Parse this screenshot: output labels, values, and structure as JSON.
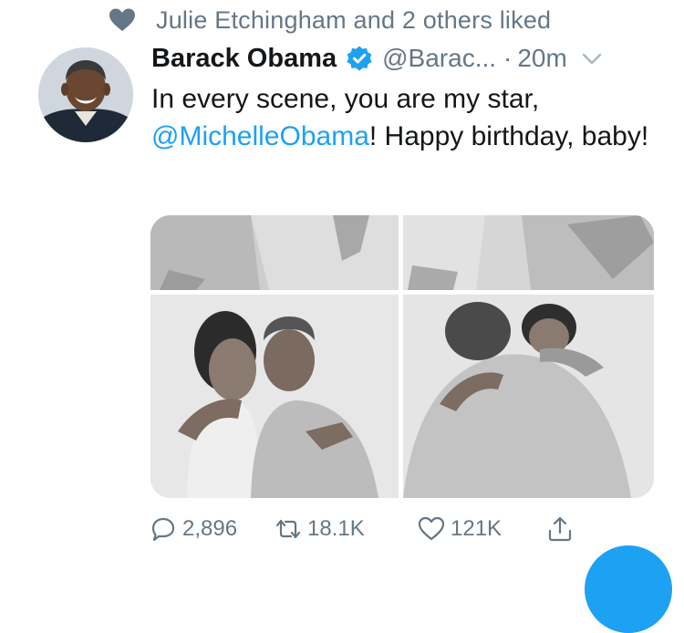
{
  "social_context": {
    "icon": "heart-icon",
    "text": "Julie Etchingham and 2 others liked"
  },
  "tweet": {
    "author_name": "Barack Obama",
    "verified": true,
    "handle": "@Barac...",
    "separator": "·",
    "time": "20m",
    "text_before": "In every scene, you are my star, ",
    "mention": "@MichelleObama",
    "text_after": "! Happy birthday, baby!",
    "media": [
      "photo",
      "photo",
      "photo",
      "photo"
    ]
  },
  "actions": {
    "replies": "2,896",
    "retweets": "18.1K",
    "likes": "121K"
  },
  "colors": {
    "accent": "#1da1f2",
    "secondary_text": "#657786",
    "primary_text": "#14171a"
  }
}
